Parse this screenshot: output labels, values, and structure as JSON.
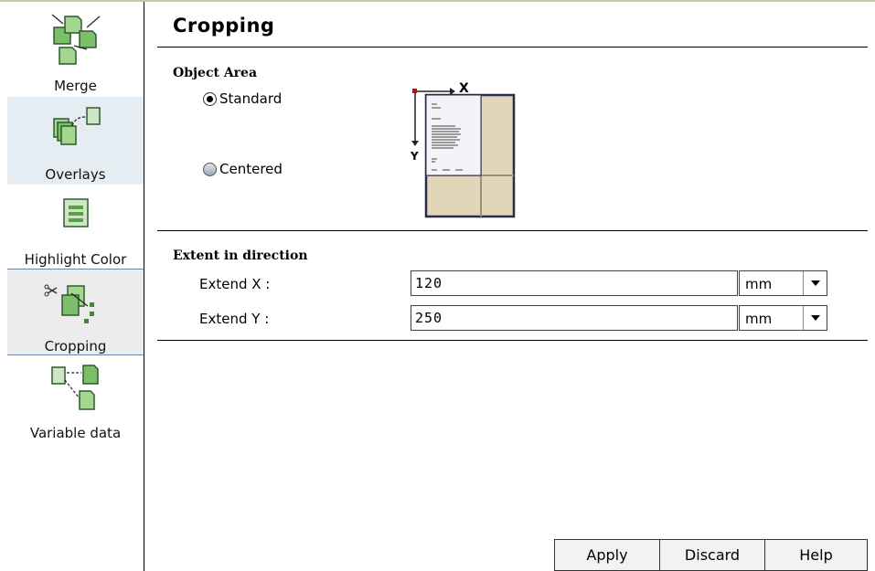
{
  "sidebar": {
    "items": [
      {
        "label": "Merge",
        "icon": "merge-icon"
      },
      {
        "label": "Overlays",
        "icon": "overlays-icon"
      },
      {
        "label": "Highlight Color",
        "icon": "highlight-color-icon"
      },
      {
        "label": "Cropping",
        "icon": "cropping-icon",
        "selected": true
      },
      {
        "label": "Variable data",
        "icon": "variable-data-icon"
      }
    ]
  },
  "main": {
    "title": "Cropping",
    "object_area": {
      "label": "Object Area",
      "options": [
        {
          "label": "Standard",
          "selected": true
        },
        {
          "label": "Centered",
          "selected": false
        }
      ],
      "diagram": {
        "x_label": "X",
        "y_label": "Y"
      }
    },
    "extent": {
      "label": "Extent in direction",
      "fields": [
        {
          "label": "Extend X :",
          "value": "120",
          "unit": "mm"
        },
        {
          "label": "Extend Y :",
          "value": "250",
          "unit": "mm"
        }
      ]
    }
  },
  "buttons": {
    "apply": "Apply",
    "discard": "Discard",
    "help": "Help"
  },
  "colors": {
    "sidebar_highlight": "#e6edf2",
    "paper": "#e3d6b8",
    "origin_marker": "#e00000"
  }
}
